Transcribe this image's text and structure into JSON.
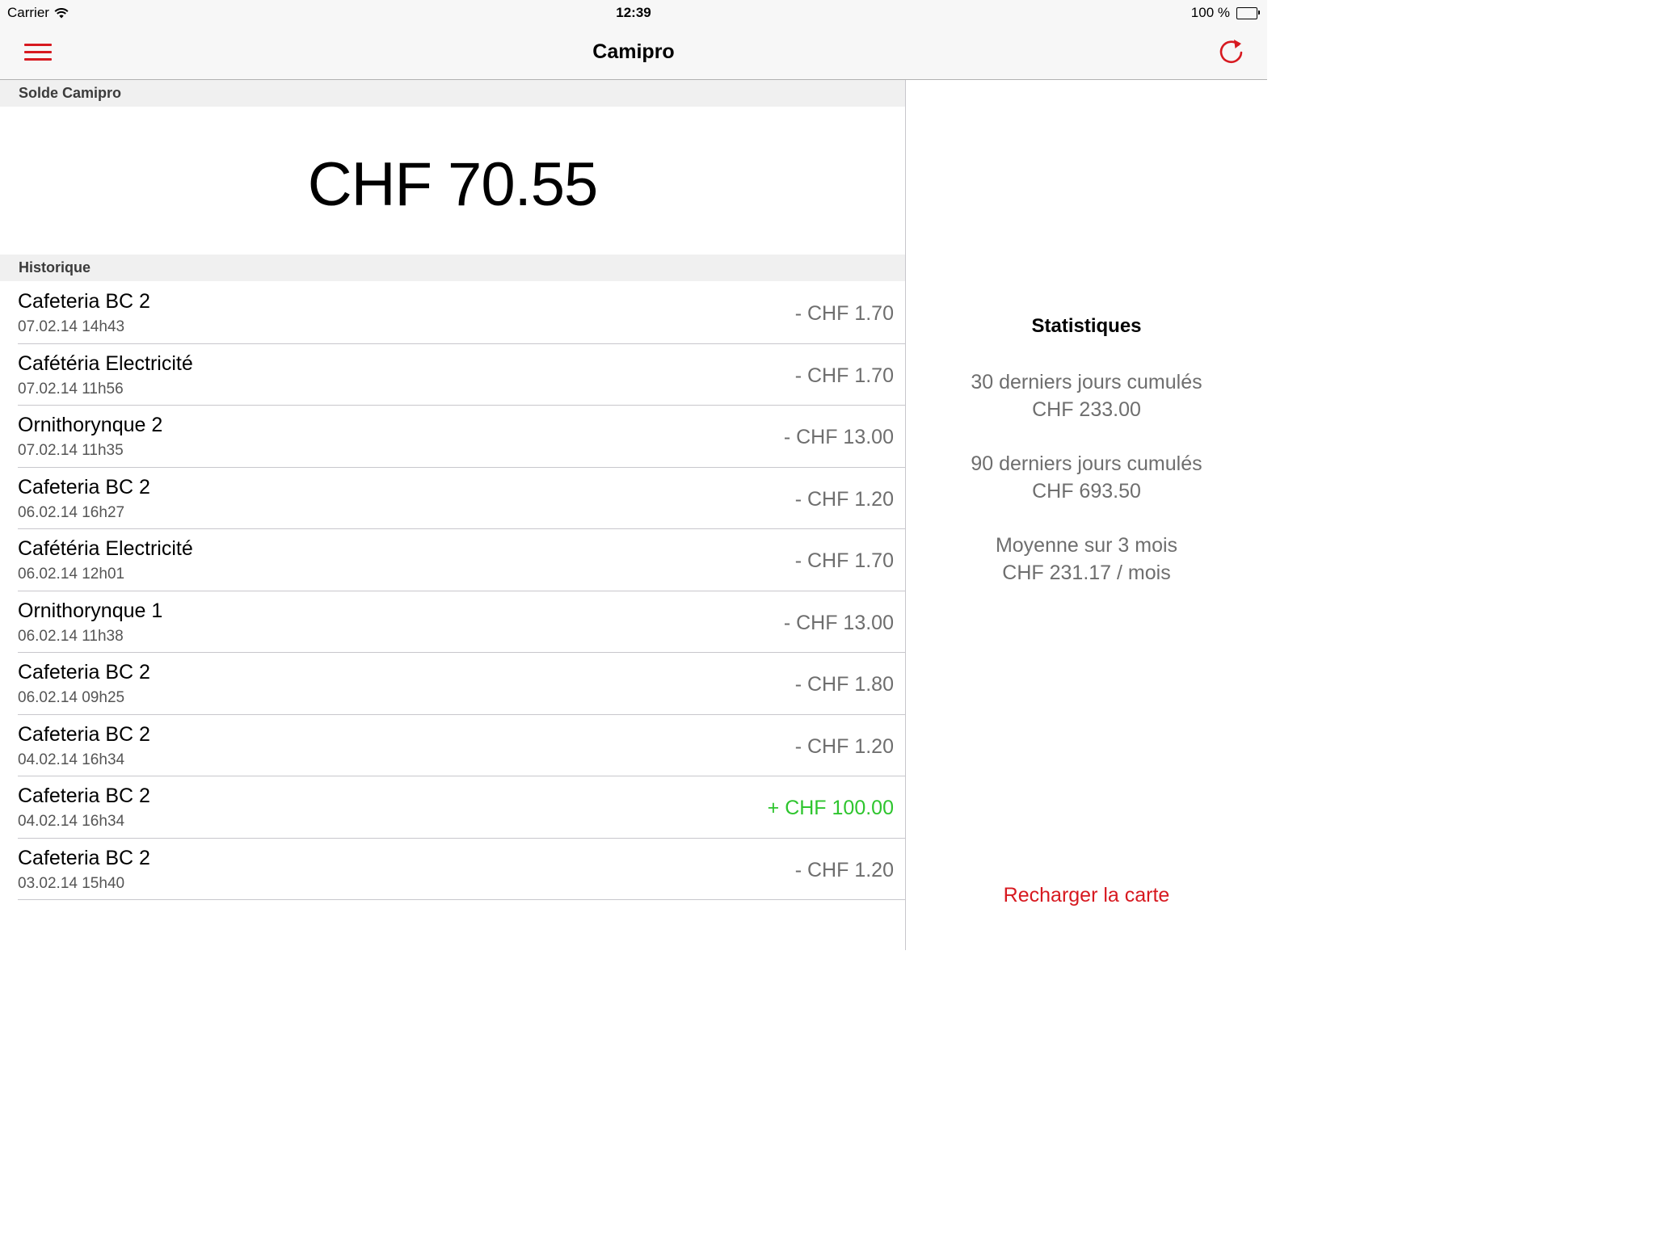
{
  "status_bar": {
    "carrier": "Carrier",
    "time": "12:39",
    "battery": "100 %"
  },
  "nav": {
    "title": "Camipro",
    "menu_icon": "hamburger-menu-icon",
    "refresh_icon": "refresh-icon",
    "accent_color": "#d71920"
  },
  "balance_section": {
    "header": "Solde Camipro",
    "amount": "CHF 70.55"
  },
  "history_section": {
    "header": "Historique",
    "rows": [
      {
        "place": "Cafeteria BC 2",
        "date": "07.02.14 14h43",
        "amount": "- CHF 1.70",
        "credit": false
      },
      {
        "place": "Cafétéria Electricité",
        "date": "07.02.14 11h56",
        "amount": "- CHF 1.70",
        "credit": false
      },
      {
        "place": "Ornithorynque 2",
        "date": "07.02.14 11h35",
        "amount": "- CHF 13.00",
        "credit": false
      },
      {
        "place": "Cafeteria BC 2",
        "date": "06.02.14 16h27",
        "amount": "- CHF 1.20",
        "credit": false
      },
      {
        "place": "Cafétéria Electricité",
        "date": "06.02.14 12h01",
        "amount": "- CHF 1.70",
        "credit": false
      },
      {
        "place": "Ornithorynque 1",
        "date": "06.02.14 11h38",
        "amount": "- CHF 13.00",
        "credit": false
      },
      {
        "place": "Cafeteria BC 2",
        "date": "06.02.14 09h25",
        "amount": "- CHF 1.80",
        "credit": false
      },
      {
        "place": "Cafeteria BC 2",
        "date": "04.02.14 16h34",
        "amount": "- CHF 1.20",
        "credit": false
      },
      {
        "place": "Cafeteria BC 2",
        "date": "04.02.14 16h34",
        "amount": "+ CHF 100.00",
        "credit": true
      },
      {
        "place": "Cafeteria BC 2",
        "date": "03.02.14 15h40",
        "amount": "- CHF 1.20",
        "credit": false
      }
    ]
  },
  "statistics": {
    "title": "Statistiques",
    "blocks": [
      {
        "label": "30 derniers jours cumulés",
        "value": "CHF 233.00"
      },
      {
        "label": "90 derniers jours cumulés",
        "value": "CHF 693.50"
      },
      {
        "label": "Moyenne sur 3 mois",
        "value": "CHF 231.17 / mois"
      }
    ],
    "reload_label": "Recharger la carte"
  },
  "colors": {
    "credit": "#2ec52e",
    "debit": "#6e6e6e"
  }
}
